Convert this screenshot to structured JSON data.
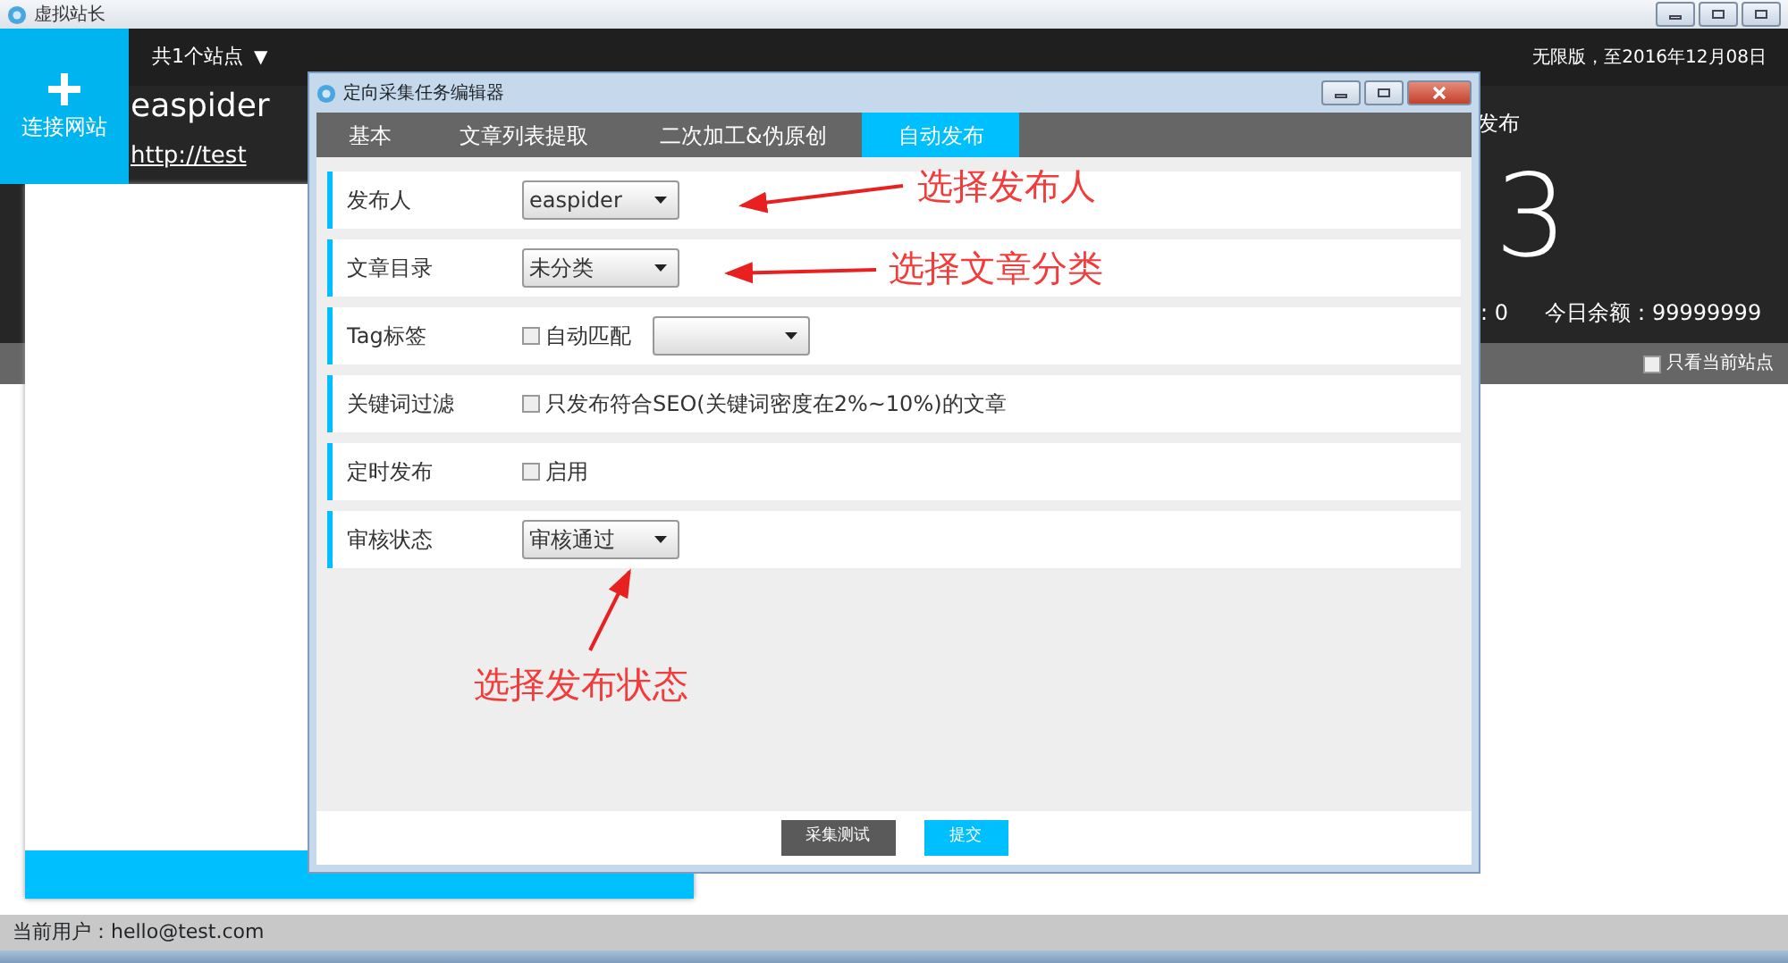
{
  "app": {
    "title": "虚拟站长"
  },
  "header": {
    "connect_button": "连接网站",
    "site_count": "共1个站点",
    "dropdown_glyph": "▼",
    "license": "无限版，至2016年12月08日"
  },
  "site": {
    "name": "easpider",
    "url": "http://test",
    "stat_label": "发布",
    "stat_value": "3",
    "count": ": 0",
    "today_balance": "今日余额：99999999"
  },
  "filter": {
    "label": "只看当前站点",
    "checked": false
  },
  "status_bar": "当前用户：hello@test.com",
  "dialog": {
    "title": "定向采集任务编辑器",
    "tabs": [
      {
        "label": "基本",
        "selected": false
      },
      {
        "label": "文章列表提取",
        "selected": false
      },
      {
        "label": "二次加工&伪原创",
        "selected": false
      },
      {
        "label": "自动发布",
        "selected": true
      }
    ],
    "rows": [
      {
        "label": "发布人",
        "kind": "select",
        "value": "easpider"
      },
      {
        "label": "文章目录",
        "kind": "select",
        "value": "未分类"
      },
      {
        "label": "Tag标签",
        "kind": "checkbox_select",
        "checkbox": "自动匹配",
        "checked": false
      },
      {
        "label": "关键词过滤",
        "kind": "checkbox",
        "checkbox": "只发布符合SEO(关键词密度在2%~10%)的文章",
        "checked": false
      },
      {
        "label": "定时发布",
        "kind": "checkbox",
        "checkbox": "启用",
        "checked": false
      },
      {
        "label": "审核状态",
        "kind": "select",
        "value": "审核通过"
      }
    ],
    "buttons": [
      {
        "label": "采集测试",
        "kind": "secondary"
      },
      {
        "label": "提交",
        "kind": "primary"
      }
    ]
  },
  "annotations": [
    {
      "text": "选择发布人"
    },
    {
      "text": "选择文章分类"
    },
    {
      "text": "选择发布状态"
    }
  ]
}
